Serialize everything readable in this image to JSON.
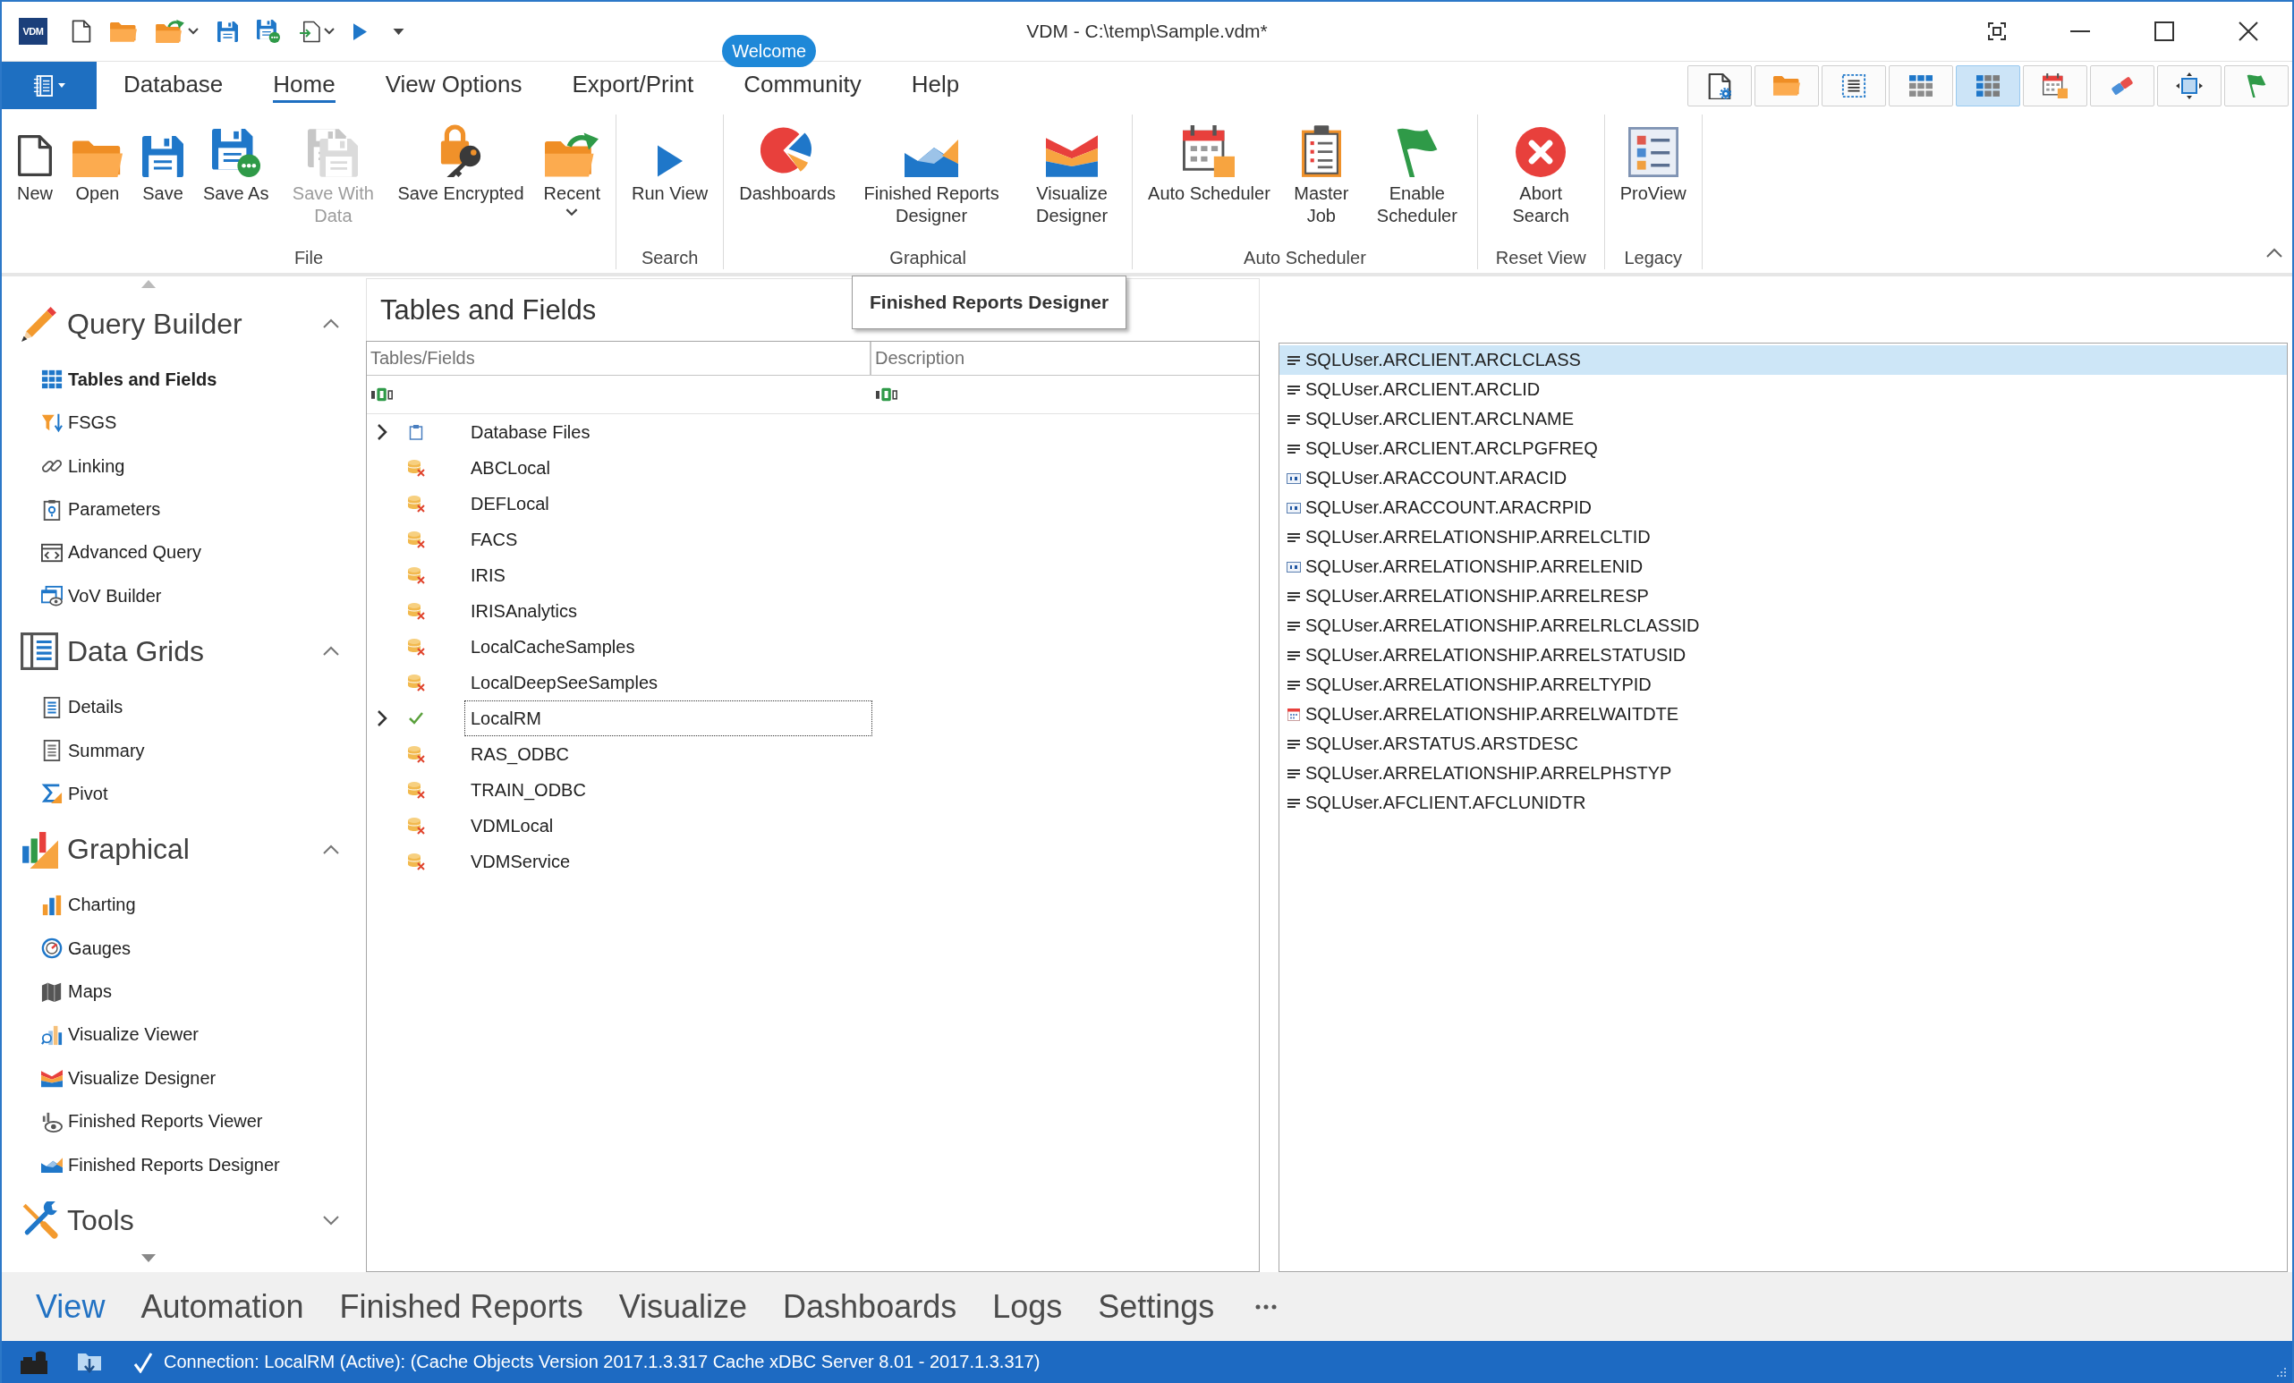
{
  "window": {
    "logo": "VDM",
    "title": "VDM - C:\\temp\\Sample.vdm*"
  },
  "ribbon_tabs": [
    {
      "label": "Database",
      "selected": false
    },
    {
      "label": "Home",
      "selected": true
    },
    {
      "label": "View Options",
      "selected": false
    },
    {
      "label": "Export/Print",
      "selected": false
    },
    {
      "label": "Community",
      "selected": false,
      "badge": "Welcome"
    },
    {
      "label": "Help",
      "selected": false
    }
  ],
  "view_toolbar": [
    {
      "selected": false
    },
    {
      "selected": false
    },
    {
      "selected": false
    },
    {
      "selected": false
    },
    {
      "selected": true
    },
    {
      "selected": false
    },
    {
      "selected": false
    },
    {
      "selected": false
    },
    {
      "selected": false
    }
  ],
  "ribbon_groups": [
    {
      "label": "File",
      "buttons": [
        {
          "label": "New",
          "disabled": false
        },
        {
          "label": "Open",
          "disabled": false
        },
        {
          "label": "Save",
          "disabled": false
        },
        {
          "label": "Save As",
          "disabled": false
        },
        {
          "label": "Save With Data",
          "disabled": true
        },
        {
          "label": "Save Encrypted",
          "disabled": false
        },
        {
          "label": "Recent",
          "disabled": false,
          "dropdown": true
        }
      ]
    },
    {
      "label": "Search",
      "buttons": [
        {
          "label": "Run View",
          "disabled": false
        }
      ]
    },
    {
      "label": "Graphical",
      "buttons": [
        {
          "label": "Dashboards",
          "disabled": false
        },
        {
          "label": "Finished Reports Designer",
          "disabled": false
        },
        {
          "label": "Visualize Designer",
          "disabled": false
        }
      ]
    },
    {
      "label": "Auto Scheduler",
      "buttons": [
        {
          "label": "Auto Scheduler",
          "disabled": false
        },
        {
          "label": "Master Job",
          "disabled": false
        },
        {
          "label": "Enable Scheduler",
          "disabled": false
        }
      ]
    },
    {
      "label": "Reset View",
      "buttons": [
        {
          "label": "Abort Search",
          "disabled": false
        }
      ]
    },
    {
      "label": "Legacy",
      "buttons": [
        {
          "label": "ProView",
          "disabled": false
        }
      ]
    }
  ],
  "sidebar": {
    "sections": [
      {
        "title": "Query Builder",
        "expanded": true,
        "items": [
          {
            "label": "Tables and Fields",
            "selected": true
          },
          {
            "label": "FSGS",
            "selected": false
          },
          {
            "label": "Linking",
            "selected": false
          },
          {
            "label": "Parameters",
            "selected": false
          },
          {
            "label": "Advanced Query",
            "selected": false
          },
          {
            "label": "VoV Builder",
            "selected": false
          }
        ]
      },
      {
        "title": "Data Grids",
        "expanded": true,
        "items": [
          {
            "label": "Details",
            "selected": false
          },
          {
            "label": "Summary",
            "selected": false
          },
          {
            "label": "Pivot",
            "selected": false
          }
        ]
      },
      {
        "title": "Graphical",
        "expanded": true,
        "items": [
          {
            "label": "Charting",
            "selected": false
          },
          {
            "label": "Gauges",
            "selected": false
          },
          {
            "label": "Maps",
            "selected": false
          },
          {
            "label": "Visualize Viewer",
            "selected": false
          },
          {
            "label": "Visualize Designer",
            "selected": false
          },
          {
            "label": "Finished Reports Viewer",
            "selected": false
          },
          {
            "label": "Finished Reports Designer",
            "selected": false
          }
        ]
      },
      {
        "title": "Tools",
        "expanded": false
      }
    ]
  },
  "tables_panel": {
    "title": "Tables and Fields",
    "tooltip": "Finished Reports Designer",
    "columns": [
      "Tables/Fields",
      "Description"
    ],
    "rows": [
      {
        "label": "Database Files",
        "kind": "folder",
        "expanded": false,
        "selected": false
      },
      {
        "label": "ABCLocal",
        "kind": "database",
        "connected": false,
        "selected": false
      },
      {
        "label": "DEFLocal",
        "kind": "database",
        "connected": false,
        "selected": false
      },
      {
        "label": "FACS",
        "kind": "database",
        "connected": false,
        "selected": false
      },
      {
        "label": "IRIS",
        "kind": "database",
        "connected": false,
        "selected": false
      },
      {
        "label": "IRISAnalytics",
        "kind": "database",
        "connected": false,
        "selected": false
      },
      {
        "label": "LocalCacheSamples",
        "kind": "database",
        "connected": false,
        "selected": false
      },
      {
        "label": "LocalDeepSeeSamples",
        "kind": "database",
        "connected": false,
        "selected": false
      },
      {
        "label": "LocalRM",
        "kind": "database",
        "connected": true,
        "expanded": false,
        "selected": true
      },
      {
        "label": "RAS_ODBC",
        "kind": "database",
        "connected": false,
        "selected": false
      },
      {
        "label": "TRAIN_ODBC",
        "kind": "database",
        "connected": false,
        "selected": false
      },
      {
        "label": "VDMLocal",
        "kind": "database",
        "connected": false,
        "selected": false
      },
      {
        "label": "VDMService",
        "kind": "database",
        "connected": false,
        "selected": false
      }
    ]
  },
  "fields_list": {
    "items": [
      {
        "name": "SQLUser.ARCLIENT.ARCLCLASS",
        "kind": "text",
        "selected": true
      },
      {
        "name": "SQLUser.ARCLIENT.ARCLID",
        "kind": "text",
        "selected": false
      },
      {
        "name": "SQLUser.ARCLIENT.ARCLNAME",
        "kind": "text",
        "selected": false
      },
      {
        "name": "SQLUser.ARCLIENT.ARCLPGFREQ",
        "kind": "text",
        "selected": false
      },
      {
        "name": "SQLUser.ARACCOUNT.ARACID",
        "kind": "number",
        "selected": false
      },
      {
        "name": "SQLUser.ARACCOUNT.ARACRPID",
        "kind": "number",
        "selected": false
      },
      {
        "name": "SQLUser.ARRELATIONSHIP.ARRELCLTID",
        "kind": "text",
        "selected": false
      },
      {
        "name": "SQLUser.ARRELATIONSHIP.ARRELENID",
        "kind": "number",
        "selected": false
      },
      {
        "name": "SQLUser.ARRELATIONSHIP.ARRELRESP",
        "kind": "text",
        "selected": false
      },
      {
        "name": "SQLUser.ARRELATIONSHIP.ARRELRLCLASSID",
        "kind": "text",
        "selected": false
      },
      {
        "name": "SQLUser.ARRELATIONSHIP.ARRELSTATUSID",
        "kind": "text",
        "selected": false
      },
      {
        "name": "SQLUser.ARRELATIONSHIP.ARRELTYPID",
        "kind": "text",
        "selected": false
      },
      {
        "name": "SQLUser.ARRELATIONSHIP.ARRELWAITDTE",
        "kind": "date",
        "selected": false
      },
      {
        "name": "SQLUser.ARSTATUS.ARSTDESC",
        "kind": "text",
        "selected": false
      },
      {
        "name": "SQLUser.ARRELATIONSHIP.ARRELPHSTYP",
        "kind": "text",
        "selected": false
      },
      {
        "name": "SQLUser.AFCLIENT.AFCLUNIDTR",
        "kind": "text",
        "selected": false
      }
    ]
  },
  "bottom_nav": [
    {
      "label": "View",
      "selected": true
    },
    {
      "label": "Automation",
      "selected": false
    },
    {
      "label": "Finished Reports",
      "selected": false
    },
    {
      "label": "Visualize",
      "selected": false
    },
    {
      "label": "Dashboards",
      "selected": false
    },
    {
      "label": "Logs",
      "selected": false
    },
    {
      "label": "Settings",
      "selected": false
    }
  ],
  "status_bar": {
    "text": "Connection: LocalRM (Active): (Cache Objects Version 2017.1.3.317 Cache xDBC Server 8.01 - 2017.1.3.317)"
  }
}
